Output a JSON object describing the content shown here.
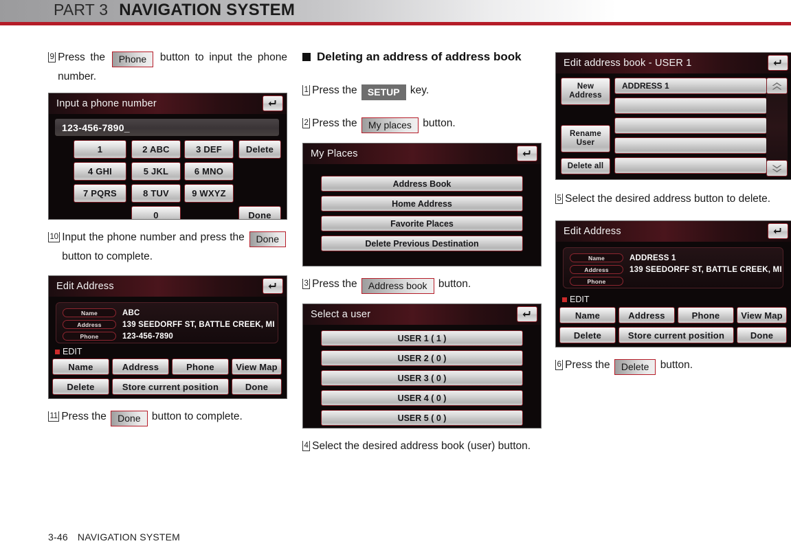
{
  "header": {
    "part_label": "PART 3",
    "part_title": "NAVIGATION SYSTEM"
  },
  "footer": {
    "page": "3-46",
    "title": "NAVIGATION SYSTEM"
  },
  "left_column": {
    "step9": {
      "num": "9",
      "text_before": "Press the",
      "button": "Phone",
      "text_after": "button to input the phone number."
    },
    "keypad_screen": {
      "title": "Input a phone number",
      "back_icon": "return-arrow-icon",
      "display_value": "123-456-7890_",
      "keys": [
        "1",
        "2 ABC",
        "3 DEF",
        "4 GHI",
        "5 JKL",
        "6 MNO",
        "7 PQRS",
        "8 TUV",
        "9 WXYZ",
        "0"
      ],
      "delete_label": "Delete",
      "done_label": "Done"
    },
    "step10": {
      "num": "10",
      "text_before": "Input the phone number and press the",
      "button": "Done",
      "text_after": "button to complete."
    },
    "edit_address_screen": {
      "title": "Edit Address",
      "back_icon": "return-arrow-icon",
      "fields": [
        {
          "label": "Name",
          "value": "ABC"
        },
        {
          "label": "Address",
          "value": "139 SEEDORFF ST, BATTLE CREEK, MI"
        },
        {
          "label": "Phone",
          "value": "123-456-7890"
        }
      ],
      "edit_label": "EDIT",
      "buttons_row1": [
        "Name",
        "Address",
        "Phone",
        "View Map"
      ],
      "buttons_row2": [
        "Delete",
        "Store current position",
        "Done"
      ]
    },
    "step11": {
      "num": "11",
      "text_before": "Press the",
      "button": "Done",
      "text_after": "button to complete."
    }
  },
  "mid_column": {
    "section_heading": "Deleting an address of address book",
    "step1": {
      "num": "1",
      "text_before": "Press the",
      "key": "SETUP",
      "text_after": "key."
    },
    "step2": {
      "num": "2",
      "text_before": "Press the",
      "button": "My places",
      "text_after": "button."
    },
    "my_places_screen": {
      "title": "My Places",
      "back_icon": "return-arrow-icon",
      "items": [
        "Address Book",
        "Home Address",
        "Favorite Places",
        "Delete Previous Destination"
      ]
    },
    "step3": {
      "num": "3",
      "text_before": "Press the",
      "button": "Address book",
      "text_after": "button."
    },
    "select_user_screen": {
      "title": "Select a user",
      "back_icon": "return-arrow-icon",
      "items": [
        "USER 1 ( 1 )",
        "USER 2 ( 0 )",
        "USER 3 ( 0 )",
        "USER 4 ( 0 )",
        "USER 5 ( 0 )"
      ]
    },
    "step4": {
      "num": "4",
      "text": "Select the desired address book (user) button."
    }
  },
  "right_column": {
    "edit_address_book_screen": {
      "title": "Edit address book - USER 1",
      "back_icon": "return-arrow-icon",
      "side_buttons": [
        "New Address",
        "Rename User",
        "Delete all"
      ],
      "list_items": [
        "ADDRESS 1",
        "",
        "",
        "",
        ""
      ],
      "scroll_up_icon": "double-chevron-up-icon",
      "scroll_down_icon": "double-chevron-down-icon"
    },
    "step5": {
      "num": "5",
      "text": "Select the desired address button to delete."
    },
    "edit_address_screen": {
      "title": "Edit Address",
      "back_icon": "return-arrow-icon",
      "fields": [
        {
          "label": "Name",
          "value": "ADDRESS 1"
        },
        {
          "label": "Address",
          "value": "139 SEEDORFF ST, BATTLE CREEK, MI"
        },
        {
          "label": "Phone",
          "value": ""
        }
      ],
      "edit_label": "EDIT",
      "buttons_row1": [
        "Name",
        "Address",
        "Phone",
        "View Map"
      ],
      "buttons_row2": [
        "Delete",
        "Store current position",
        "Done"
      ]
    },
    "step6": {
      "num": "6",
      "text_before": "Press the",
      "button": "Delete",
      "text_after": "button."
    }
  },
  "colors": {
    "brand_red": "#b51c28",
    "screen_bg": "#0d0809",
    "button_border_red": "#7e1c24"
  }
}
